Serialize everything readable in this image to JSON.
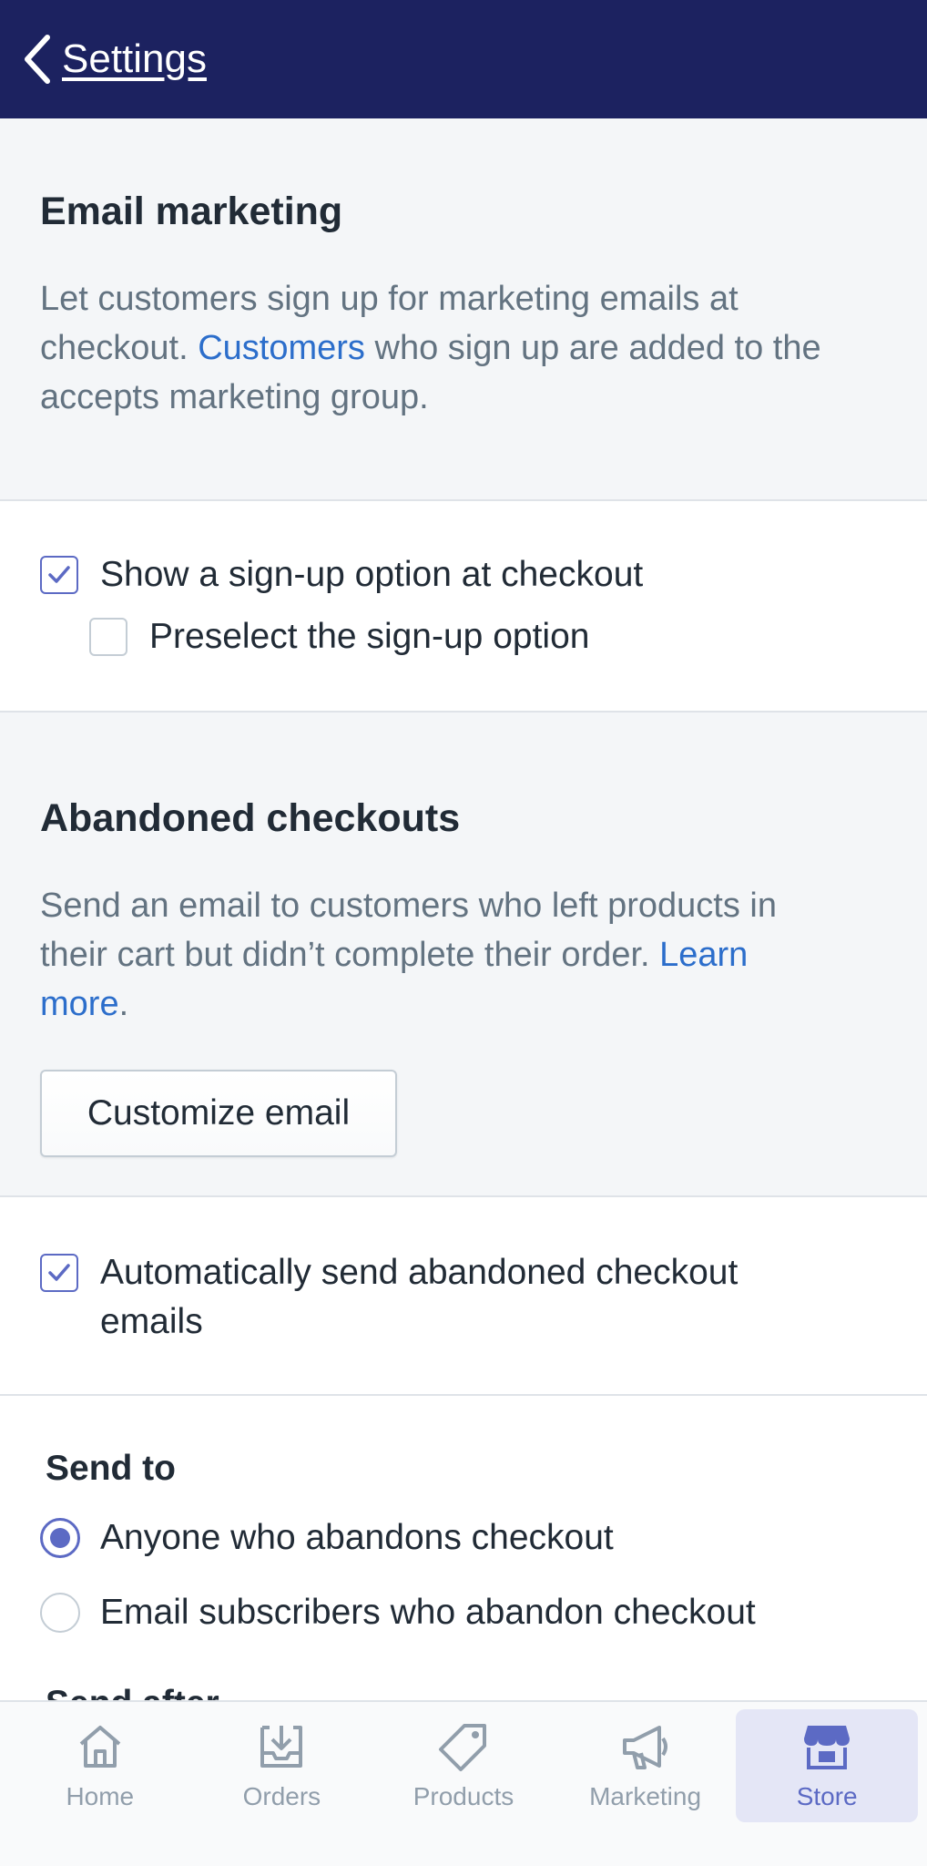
{
  "header": {
    "back_label": "Settings"
  },
  "email_marketing": {
    "title": "Email marketing",
    "desc_before": "Let customers sign up for marketing emails at checkout. ",
    "desc_link": "Customers",
    "desc_after": " who sign up are added to the accepts marketing group.",
    "options": [
      {
        "label": "Show a sign-up option at checkout",
        "checked": true
      },
      {
        "label": "Preselect the sign-up option",
        "checked": false
      }
    ]
  },
  "abandoned_checkouts": {
    "title": "Abandoned checkouts",
    "desc_before": "Send an email to customers who left products in their cart but didn’t complete their order. ",
    "desc_link": "Learn more",
    "desc_after": ".",
    "button_label": "Customize email",
    "auto_send": {
      "label": "Automatically send abandoned checkout emails",
      "checked": true
    }
  },
  "send_to": {
    "title": "Send to",
    "options": [
      {
        "label": "Anyone who abandons checkout",
        "selected": true
      },
      {
        "label": "Email subscribers who abandon checkout",
        "selected": false
      }
    ],
    "next_title_partial": "Send after"
  },
  "bottom_nav": {
    "items": [
      {
        "label": "Home",
        "icon": "home-icon",
        "active": false
      },
      {
        "label": "Orders",
        "icon": "orders-icon",
        "active": false
      },
      {
        "label": "Products",
        "icon": "tag-icon",
        "active": false
      },
      {
        "label": "Marketing",
        "icon": "megaphone-icon",
        "active": false
      },
      {
        "label": "Store",
        "icon": "store-icon",
        "active": true
      }
    ]
  },
  "colors": {
    "header_bg": "#1c2260",
    "accent": "#5c6ac4",
    "link": "#2c6ecb"
  }
}
